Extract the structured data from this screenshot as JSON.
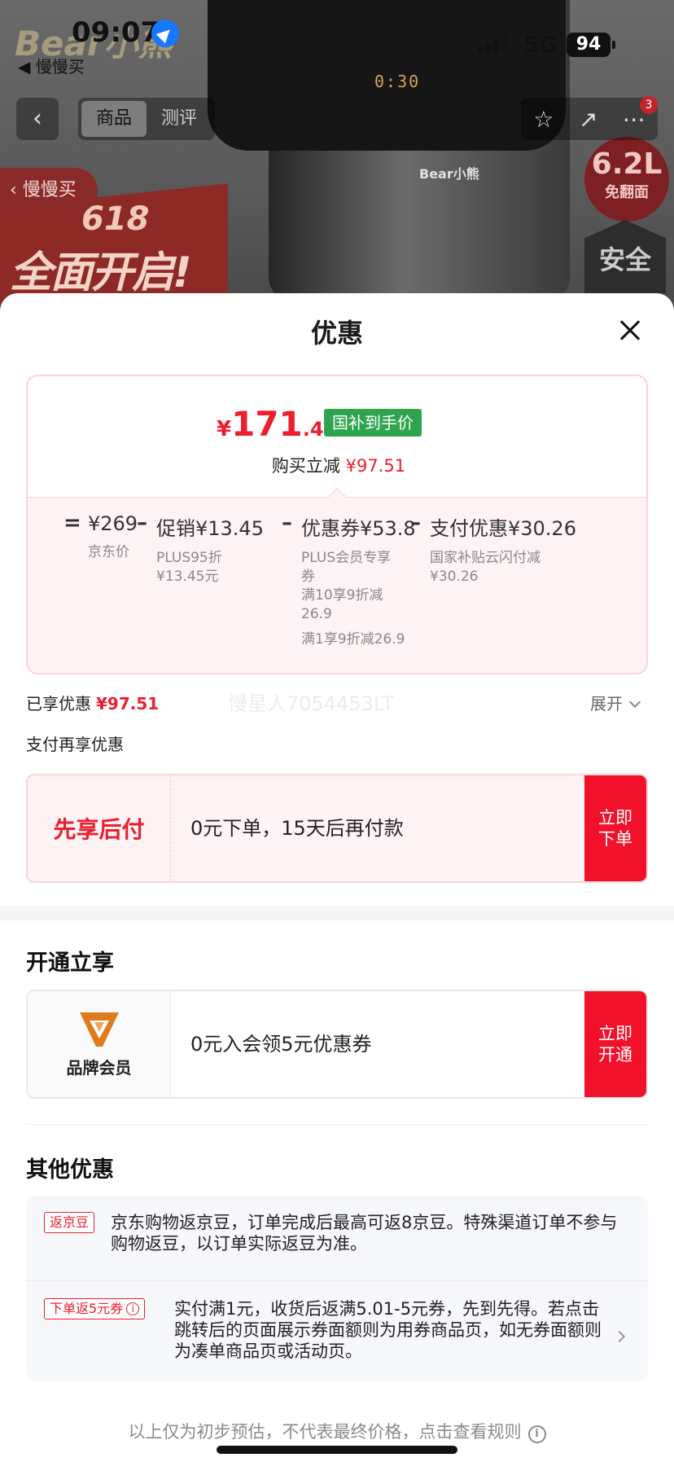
{
  "status_bar": {
    "time": "09:07",
    "back_app": "◀ 慢慢买",
    "network": "5G",
    "battery": "94"
  },
  "product_bg": {
    "fryer_display": "0:30",
    "fryer_brand": "Bear小熊",
    "logo": "Bear小熊",
    "promo_number": "618",
    "promo_text": "全面开启!",
    "capacity_value": "6.2L",
    "capacity_sub": "免翻面",
    "safety_badge": "安全"
  },
  "nav": {
    "back_label": "‹",
    "tabs": [
      {
        "label": "商品"
      },
      {
        "label": "测评"
      }
    ],
    "cart_badge": "3",
    "slow_buy_label": "‹ 慢慢买"
  },
  "sheet": {
    "title": "优惠",
    "price": {
      "symbol": "¥",
      "integer": "171",
      "decimal": ".49",
      "badge": "国补到手价",
      "saving_label": "购买立减",
      "saving_amount": "¥97.51"
    },
    "breakdown": {
      "eq": "=",
      "minus": "–",
      "items": [
        {
          "value": "¥269",
          "sub": "京东价"
        },
        {
          "value": "促销¥13.45",
          "sub": "PLUS95折",
          "sub2": "¥13.45元"
        },
        {
          "value": "优惠券¥53.8",
          "sub": "PLUS会员专享",
          "sub2": "券",
          "sub3": "满10享9折减",
          "sub4": "26.9",
          "sub5": "满1享9折减26.9"
        },
        {
          "value": "支付优惠¥30.26",
          "sub": "国家补贴云闪付减",
          "sub2": "¥30.26"
        }
      ]
    },
    "enjoyed_label": "已享优惠",
    "enjoyed_amount": "¥97.51",
    "watermark": "慢星人7054453LT",
    "expand_label": "展开",
    "pay_more_label": "支付再享优惠",
    "pay_later": {
      "title": "先享后付",
      "desc": "0元下单，15天后再付款",
      "button": "立即下单"
    },
    "open_section_title": "开通立享",
    "member": {
      "label": "品牌会员",
      "desc": "0元入会领5元优惠券",
      "button": "立即开通",
      "logo_color": "#e07a1f"
    },
    "other_section_title": "其他优惠",
    "other_offers": [
      {
        "tag": "返京豆",
        "text": "京东购物返京豆，订单完成后最高可返8京豆。特殊渠道订单不参与购物返豆，以订单实际返豆为准。"
      },
      {
        "tag": "下单返5元券",
        "text": "实付满1元，收货后返满5.01-5元券，先到先得。若点击跳转后的页面展示券面额则为用券商品页，如无券面额则为凑单商品页或活动页。"
      }
    ],
    "footer_note": "以上仅为初步预估，不代表最终价格，点击查看规则"
  },
  "colors": {
    "accent_red": "#e8202f",
    "button_red": "#f2112a",
    "badge_green": "#2ea44f",
    "card_bg": "#fdf3f4"
  }
}
